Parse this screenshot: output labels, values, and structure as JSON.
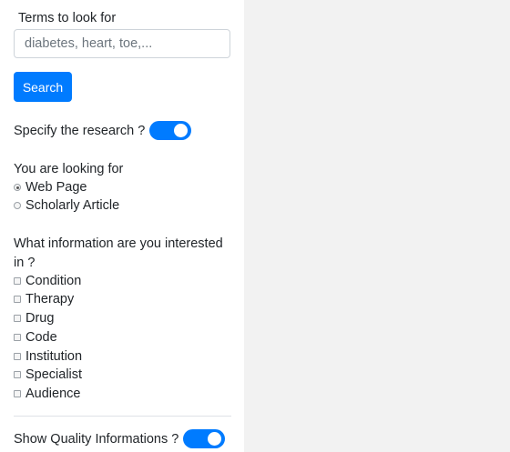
{
  "search": {
    "label": "Terms to look for",
    "placeholder": "diabetes, heart, toe,...",
    "value": "",
    "button_label": "Search"
  },
  "specify_toggle": {
    "label": "Specify the research ?",
    "on": true
  },
  "looking_for": {
    "title": "You are looking for",
    "options": [
      {
        "label": "Web Page",
        "checked": true
      },
      {
        "label": "Scholarly Article",
        "checked": false
      }
    ]
  },
  "information": {
    "title_line1": "What information are you interested",
    "title_line2": "in ?",
    "options": [
      {
        "label": "Condition",
        "checked": false
      },
      {
        "label": "Therapy",
        "checked": false
      },
      {
        "label": "Drug",
        "checked": false
      },
      {
        "label": "Code",
        "checked": false
      },
      {
        "label": "Institution",
        "checked": false
      },
      {
        "label": "Specialist",
        "checked": false
      },
      {
        "label": "Audience",
        "checked": false
      }
    ]
  },
  "quality_toggle": {
    "label": "Show Quality Informations ?",
    "on": true
  },
  "colors": {
    "accent": "#007bff",
    "page_background": "#f2f2f2",
    "panel_background": "#ffffff"
  }
}
